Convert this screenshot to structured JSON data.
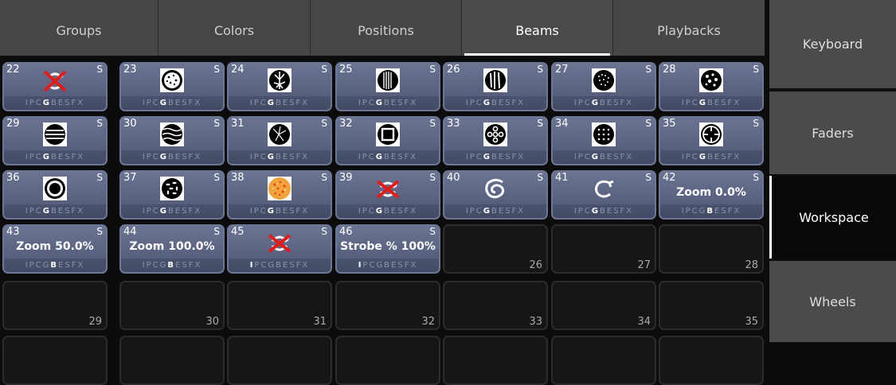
{
  "tabs": [
    {
      "label": "Groups"
    },
    {
      "label": "Colors"
    },
    {
      "label": "Positions"
    },
    {
      "label": "Beams",
      "active": true
    },
    {
      "label": "Playbacks"
    }
  ],
  "side": [
    {
      "label": "Keyboard"
    },
    {
      "label": "Faders"
    },
    {
      "label": "Workspace",
      "active": true
    },
    {
      "label": "Wheels"
    }
  ],
  "cells": [
    {
      "num": "22",
      "s": "S",
      "icon": "gobo-deleted-icon",
      "flags": "IPCGBESFX",
      "hl": "G"
    },
    {
      "num": "23",
      "s": "S",
      "icon": "gobo-dots-icon",
      "flags": "IPCGBESFX",
      "hl": "G"
    },
    {
      "num": "24",
      "s": "S",
      "icon": "gobo-branches-icon",
      "flags": "IPCGBESFX",
      "hl": "G"
    },
    {
      "num": "25",
      "s": "S",
      "icon": "gobo-vertical-lines-icon",
      "flags": "IPCGBESFX",
      "hl": "G"
    },
    {
      "num": "26",
      "s": "S",
      "icon": "gobo-bamboo-icon",
      "flags": "IPCGBESFX",
      "hl": "G"
    },
    {
      "num": "27",
      "s": "S",
      "icon": "gobo-fine-dots-icon",
      "flags": "IPCGBESFX",
      "hl": "G"
    },
    {
      "num": "28",
      "s": "S",
      "icon": "gobo-bubbles-icon",
      "flags": "IPCGBESFX",
      "hl": "G"
    },
    {
      "num": "29",
      "s": "S",
      "icon": "gobo-horizontal-bars-icon",
      "flags": "IPCGBESFX",
      "hl": "G"
    },
    {
      "num": "30",
      "s": "S",
      "icon": "gobo-waves-icon",
      "flags": "IPCGBESFX",
      "hl": "G"
    },
    {
      "num": "31",
      "s": "S",
      "icon": "gobo-broken-glass-icon",
      "flags": "IPCGBESFX",
      "hl": "G"
    },
    {
      "num": "32",
      "s": "S",
      "icon": "gobo-square-icon",
      "flags": "IPCGBESFX",
      "hl": "G"
    },
    {
      "num": "33",
      "s": "S",
      "icon": "gobo-five-circles-icon",
      "flags": "IPCGBESFX",
      "hl": "G"
    },
    {
      "num": "34",
      "s": "S",
      "icon": "gobo-dot-grid-icon",
      "flags": "IPCGBESFX",
      "hl": "G"
    },
    {
      "num": "35",
      "s": "S",
      "icon": "gobo-spiral-icon",
      "flags": "IPCGBESFX",
      "hl": "G"
    },
    {
      "num": "36",
      "s": "S",
      "icon": "gobo-ring-icon",
      "flags": "IPCGBESFX",
      "hl": "G"
    },
    {
      "num": "37",
      "s": "S",
      "icon": "gobo-leaves-icon",
      "flags": "IPCGBESFX",
      "hl": "G"
    },
    {
      "num": "38",
      "s": "S",
      "icon": "gobo-color-texture-icon",
      "flags": "IPCGBESFX",
      "hl": "G"
    },
    {
      "num": "39",
      "s": "S",
      "icon": "rotation-deleted-icon",
      "flags": "IPCGBESFX",
      "hl": "G"
    },
    {
      "num": "40",
      "s": "S",
      "icon": "rotate-ccw-icon",
      "flags": "IPCGBESFX",
      "hl": "G"
    },
    {
      "num": "41",
      "s": "S",
      "icon": "rotate-cw-icon",
      "flags": "IPCGBESFX",
      "hl": "G"
    },
    {
      "num": "42",
      "s": "S",
      "label": "Zoom 0.0%",
      "flags": "IPCGBESFX",
      "hl": "B"
    },
    {
      "num": "43",
      "s": "S",
      "label": "Zoom 50.0%",
      "flags": "IPCGBESFX",
      "hl": "B"
    },
    {
      "num": "44",
      "s": "S",
      "label": "Zoom 100.0%",
      "flags": "IPCGBESFX",
      "hl": "B"
    },
    {
      "num": "45",
      "s": "S",
      "icon": "rotation-deleted-icon",
      "flags": "IPCGBESFX",
      "hl": "I"
    },
    {
      "num": "46",
      "s": "S",
      "label": "Strobe % 100%",
      "flags": "IPCGBESFX",
      "hl": "I"
    },
    {
      "empty": "26"
    },
    {
      "empty": "27"
    },
    {
      "empty": "28"
    },
    {
      "empty": "29"
    },
    {
      "empty": "30"
    },
    {
      "empty": "31"
    },
    {
      "empty": "32"
    },
    {
      "empty": "33"
    },
    {
      "empty": "34"
    },
    {
      "empty": "35"
    },
    {
      "empty": ""
    },
    {
      "empty": ""
    },
    {
      "empty": ""
    },
    {
      "empty": ""
    },
    {
      "empty": ""
    },
    {
      "empty": ""
    },
    {
      "empty": ""
    }
  ]
}
